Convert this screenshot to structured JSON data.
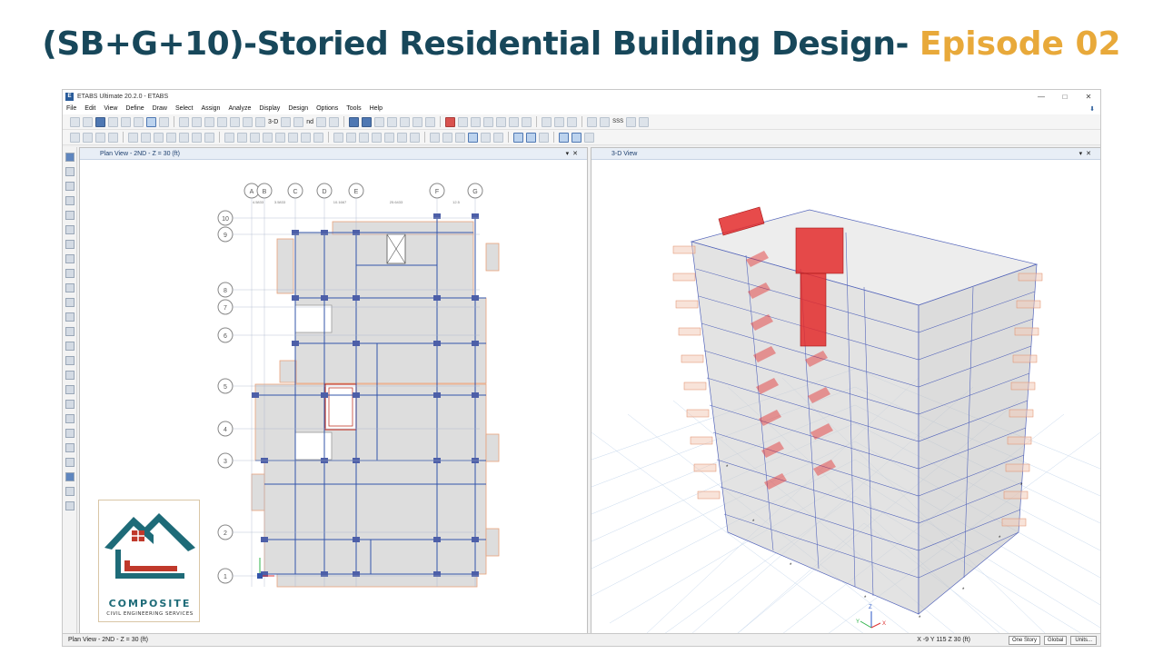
{
  "banner": {
    "title": "(SB+G+10)-Storied Residential Building Design-",
    "episode": "Episode 02"
  },
  "colors": {
    "title": "#17475a",
    "episode": "#e8a93a",
    "grid_line": "#3355aa",
    "section_red": "#e32b2b",
    "slab_gray": "#d9d9d9",
    "brand_teal": "#1e6b78"
  },
  "app": {
    "window_title": "ETABS Ultimate 20.2.0 - ETABS",
    "menu": [
      "File",
      "Edit",
      "View",
      "Define",
      "Draw",
      "Select",
      "Assign",
      "Analyze",
      "Display",
      "Design",
      "Options",
      "Tools",
      "Help"
    ],
    "toolbar_3d_label": "3-D",
    "toolbar_nd_label": "nd",
    "toolbar_sss_label": "SSS"
  },
  "plan_view": {
    "tab_title": "Plan View - 2ND - Z = 30 (ft)",
    "grid_columns": [
      "A",
      "B",
      "C",
      "D",
      "E",
      "F",
      "G"
    ],
    "grid_rows": [
      "10",
      "9",
      "8",
      "7",
      "6",
      "5",
      "4",
      "3",
      "2",
      "1"
    ],
    "dim_labels": [
      "4.5833",
      "3.5833",
      "10.1667",
      "25.6433",
      "12.5"
    ]
  },
  "view_3d": {
    "tab_title": "3-D View",
    "axes": [
      "X",
      "Y",
      "Z"
    ]
  },
  "status": {
    "left_text": "Plan View - 2ND - Z = 30 (ft)",
    "coords": "X -9  Y 115  Z 30 (ft)",
    "story_select": "One Story",
    "coord_select": "Global",
    "units_button": "Units..."
  },
  "logo": {
    "brand": "COMPOSITE",
    "tagline": "CIVIL ENGINEERING SERVICES"
  }
}
